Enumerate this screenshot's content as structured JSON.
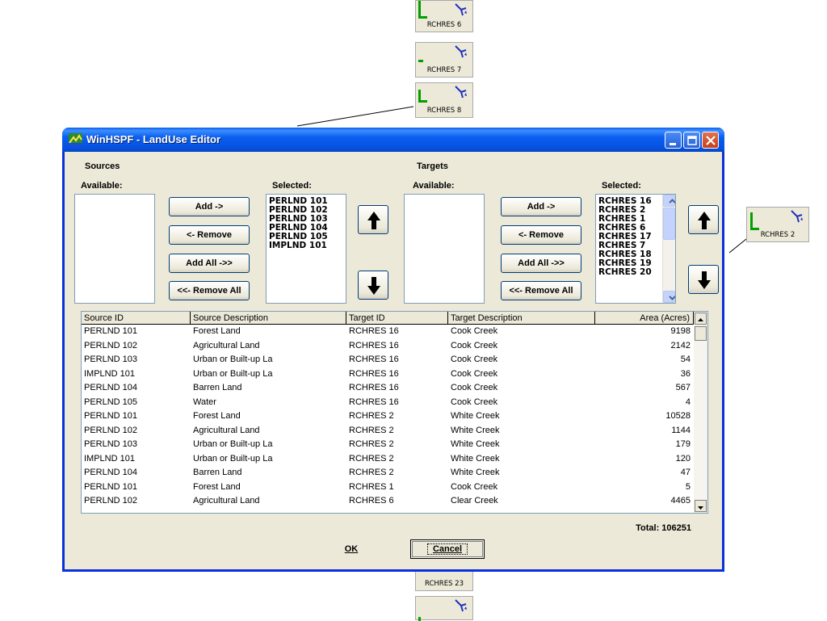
{
  "background_nodes": [
    {
      "label": "RCHRES 6"
    },
    {
      "label": "RCHRES 7"
    },
    {
      "label": "RCHRES 8"
    },
    {
      "label": "RCHRES 2"
    },
    {
      "label": "RCHRES 23"
    },
    {
      "label": ""
    }
  ],
  "window": {
    "title": "WinHSPF - LandUse Editor"
  },
  "sources": {
    "heading": "Sources",
    "available_label": "Available:",
    "selected_label": "Selected:",
    "available_items": [],
    "selected_items": [
      "PERLND 101",
      "PERLND 102",
      "PERLND 103",
      "PERLND 104",
      "PERLND 105",
      "IMPLND 101"
    ]
  },
  "targets": {
    "heading": "Targets",
    "available_label": "Available:",
    "selected_label": "Selected:",
    "available_items": [],
    "selected_items": [
      "RCHRES 16",
      "RCHRES 2",
      "RCHRES 1",
      "RCHRES 6",
      "RCHRES 17",
      "RCHRES 7",
      "RCHRES 18",
      "RCHRES 19",
      "RCHRES 20"
    ]
  },
  "buttons": {
    "add": "Add ->",
    "remove": "<- Remove",
    "add_all": "Add All ->>",
    "remove_all": "<<- Remove All",
    "ok": "OK",
    "cancel": "Cancel"
  },
  "grid": {
    "columns": [
      "Source ID",
      "Source Description",
      "Target ID",
      "Target Description",
      "Area (Acres)"
    ],
    "rows": [
      [
        "PERLND 101",
        "Forest Land",
        "RCHRES 16",
        "Cook Creek",
        "9198"
      ],
      [
        "PERLND 102",
        "Agricultural Land",
        "RCHRES 16",
        "Cook Creek",
        "2142"
      ],
      [
        "PERLND 103",
        "Urban or Built-up La",
        "RCHRES 16",
        "Cook Creek",
        "54"
      ],
      [
        "IMPLND 101",
        "Urban or Built-up La",
        "RCHRES 16",
        "Cook Creek",
        "36"
      ],
      [
        "PERLND 104",
        "Barren Land",
        "RCHRES 16",
        "Cook Creek",
        "567"
      ],
      [
        "PERLND 105",
        "Water",
        "RCHRES 16",
        "Cook Creek",
        "4"
      ],
      [
        "PERLND 101",
        "Forest Land",
        "RCHRES 2",
        "White Creek",
        "10528"
      ],
      [
        "PERLND 102",
        "Agricultural Land",
        "RCHRES 2",
        "White Creek",
        "1144"
      ],
      [
        "PERLND 103",
        "Urban or Built-up La",
        "RCHRES 2",
        "White Creek",
        "179"
      ],
      [
        "IMPLND 101",
        "Urban or Built-up La",
        "RCHRES 2",
        "White Creek",
        "120"
      ],
      [
        "PERLND 104",
        "Barren Land",
        "RCHRES 2",
        "White Creek",
        "47"
      ],
      [
        "PERLND 101",
        "Forest Land",
        "RCHRES 1",
        "Cook Creek",
        "5"
      ],
      [
        "PERLND 102",
        "Agricultural Land",
        "RCHRES 6",
        "Clear Creek",
        "4465"
      ]
    ]
  },
  "total": {
    "text": "Total: 106251"
  }
}
